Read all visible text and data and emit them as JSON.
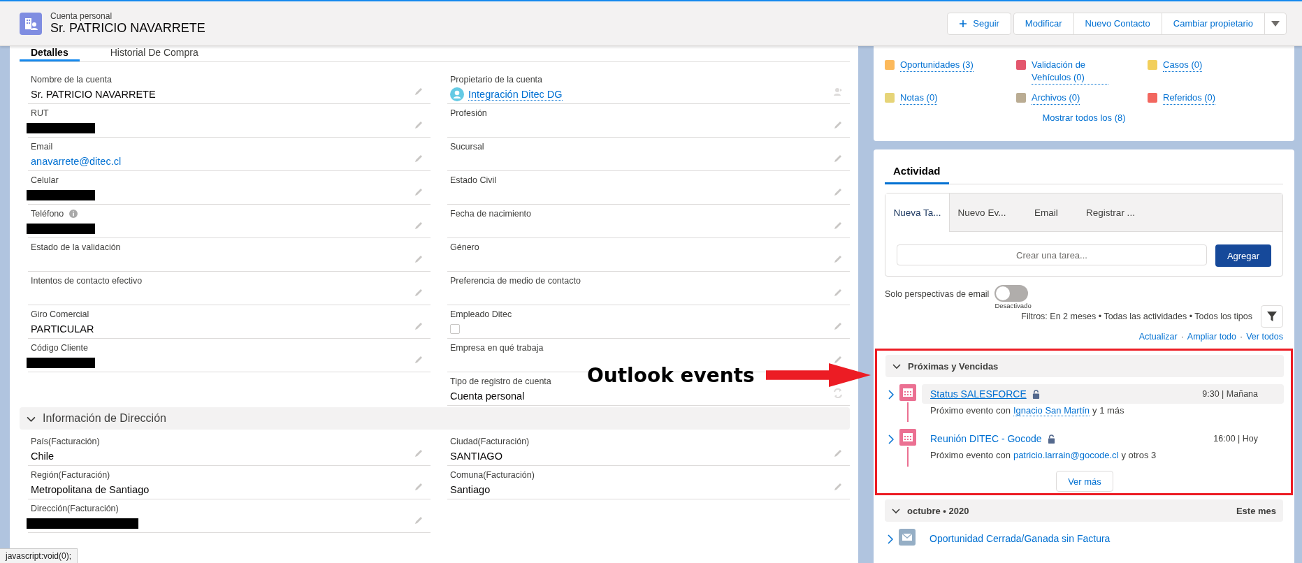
{
  "header": {
    "object_type": "Cuenta personal",
    "title": "Sr. PATRICIO NAVARRETE",
    "follow_button": "Seguir",
    "actions": [
      "Modificar",
      "Nuevo Contacto",
      "Cambiar propietario"
    ]
  },
  "detail_tabs": [
    {
      "label": "Detalles",
      "selected": true
    },
    {
      "label": "Historial De Compra",
      "selected": false
    }
  ],
  "fields_left": [
    {
      "label": "Nombre de la cuenta",
      "kind": "text",
      "value": "Sr. PATRICIO NAVARRETE"
    },
    {
      "label": "RUT",
      "kind": "redacted"
    },
    {
      "label": "Email",
      "kind": "link",
      "value": "anavarrete@ditec.cl"
    },
    {
      "label": "Celular",
      "kind": "redacted"
    },
    {
      "label": "Teléfono",
      "kind": "redacted",
      "info": true
    },
    {
      "label": "Estado de la validación",
      "kind": "text"
    },
    {
      "label": "Intentos de contacto efectivo",
      "kind": "text"
    },
    {
      "label": "Giro Comercial",
      "kind": "text",
      "value": "PARTICULAR"
    },
    {
      "label": "Código Cliente",
      "kind": "redacted"
    }
  ],
  "fields_right": [
    {
      "label": "Propietario de la cuenta",
      "kind": "owner",
      "value": "Integración Ditec DG"
    },
    {
      "label": "Profesión",
      "kind": "text"
    },
    {
      "label": "Sucursal",
      "kind": "text"
    },
    {
      "label": "Estado Civil",
      "kind": "text"
    },
    {
      "label": "Fecha de nacimiento",
      "kind": "text"
    },
    {
      "label": "Género",
      "kind": "text"
    },
    {
      "label": "Preferencia de medio de contacto",
      "kind": "text"
    },
    {
      "label": "Empleado Ditec",
      "kind": "checkbox",
      "checked": false
    },
    {
      "label": "Empresa en qué trabaja",
      "kind": "text"
    },
    {
      "label": "Tipo de registro de cuenta",
      "kind": "record-type",
      "value": "Cuenta personal"
    }
  ],
  "address_section": {
    "title": "Información de Dirección",
    "expanded": true,
    "fields_left": [
      {
        "label": "País(Facturación)",
        "kind": "text",
        "value": "Chile"
      },
      {
        "label": "Región(Facturación)",
        "kind": "text",
        "value": "Metropolitana de Santiago"
      },
      {
        "label": "Dirección(Facturación)",
        "kind": "redacted"
      }
    ],
    "fields_right": [
      {
        "label": "Ciudad(Facturación)",
        "kind": "text",
        "value": "SANTIAGO"
      },
      {
        "label": "Comuna(Facturación)",
        "kind": "text",
        "value": "Santiago"
      }
    ]
  },
  "related_lists": {
    "items": [
      {
        "label": "Oportunidades (3)",
        "color": "#fcb95b"
      },
      {
        "label": "Validación de Vehículos (0)",
        "color": "#e3566d"
      },
      {
        "label": "Casos (0)",
        "color": "#f2cf5b"
      },
      {
        "label": "Notas (0)",
        "color": "#e6d478"
      },
      {
        "label": "Archivos (0)",
        "color": "#baac93"
      },
      {
        "label": "Referidos (0)",
        "color": "#f2675f"
      }
    ],
    "show_all": "Mostrar todos los (8)"
  },
  "activity": {
    "tab": "Actividad",
    "composer_tabs": [
      {
        "label": "Nueva Ta...",
        "selected": true
      },
      {
        "label": "Nuevo Ev...",
        "selected": false
      },
      {
        "label": "Email",
        "selected": false
      },
      {
        "label": "Registrar ...",
        "selected": false
      }
    ],
    "task_field": {
      "placeholder": "Crear una tarea..."
    },
    "add_button": "Agregar",
    "email_toggle": {
      "label": "Solo perspectivas de email",
      "on": false,
      "state_text": "Desactivado"
    },
    "filters": "Filtros: En 2 meses • Todas las actividades • Todos los tipos",
    "links": [
      "Actualizar",
      "Ampliar todo",
      "Ver todos"
    ],
    "link_separator": "·",
    "groups": [
      {
        "title": "Próximas y Vencidas",
        "expanded": true,
        "outlined": true,
        "items": [
          {
            "kind": "event",
            "title": "Status SALESFORCE",
            "locked": true,
            "hovered": true,
            "time": "9:30 | Mañana",
            "desc_prefix": "Próximo evento con",
            "desc_link": "Ignacio San Martín",
            "desc_suffix": "y 1 más"
          },
          {
            "kind": "event",
            "title": "Reunión DITEC - Gocode",
            "locked": true,
            "hovered": false,
            "time": "16:00 | Hoy",
            "desc_prefix": "Próximo evento con",
            "desc_link": "patricio.larrain@gocode.cl",
            "desc_suffix": "y otros 3"
          }
        ],
        "more_button": "Ver más"
      },
      {
        "title": "octubre • 2020",
        "expanded": true,
        "outlined": false,
        "period": "Este mes",
        "items": [
          {
            "kind": "email",
            "title": "Oportunidad Cerrada/Ganada sin Factura",
            "locked": false,
            "hovered": false
          }
        ]
      }
    ]
  },
  "annotation": {
    "text": "Outlook events"
  },
  "status_url": "javascript:void(0);"
}
